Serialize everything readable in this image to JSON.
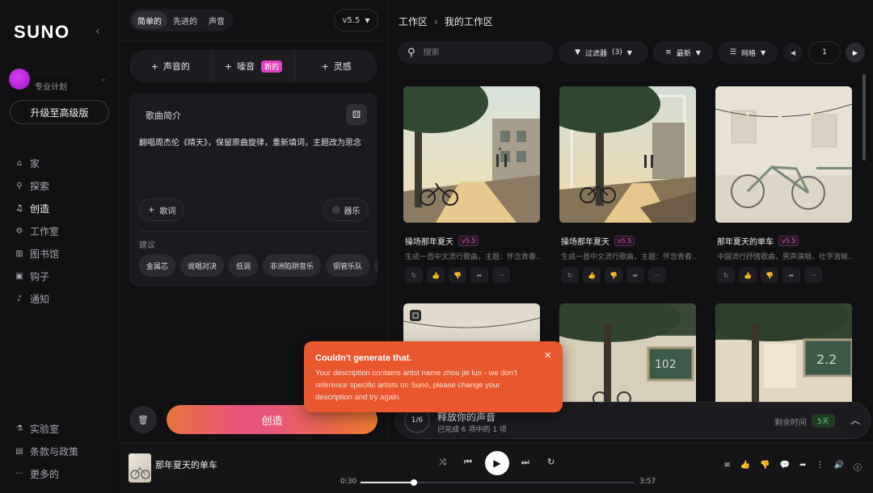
{
  "app": {
    "logo": "SUNO"
  },
  "user": {
    "name_blurred": "· · · · · · · · ·",
    "plan": "专业计划"
  },
  "sidebar": {
    "upgrade": "升级至高级版",
    "items": [
      {
        "label": "家",
        "icon": "home-icon",
        "glyph": "⌂"
      },
      {
        "label": "探索",
        "icon": "search-icon",
        "glyph": "⚲"
      },
      {
        "label": "创造",
        "icon": "music-note-icon",
        "glyph": "♫"
      },
      {
        "label": "工作室",
        "icon": "studio-icon",
        "glyph": "⚙"
      },
      {
        "label": "图书馆",
        "icon": "library-icon",
        "glyph": "▥"
      },
      {
        "label": "钩子",
        "icon": "hooks-icon",
        "glyph": "▣"
      },
      {
        "label": "通知",
        "icon": "bell-icon",
        "glyph": "♪"
      }
    ],
    "bottom": [
      {
        "label": "实验室",
        "icon": "flask-icon",
        "glyph": "⚗"
      },
      {
        "label": "条款与政策",
        "icon": "document-icon",
        "glyph": "▤"
      },
      {
        "label": "更多的",
        "icon": "more-icon",
        "glyph": "···"
      }
    ]
  },
  "create": {
    "tabs": [
      "简单的",
      "先进的",
      "声音"
    ],
    "version": "v5.5",
    "add": {
      "vocal": "声音的",
      "noise": "噪音",
      "new_badge": "新的",
      "inspiration": "灵感"
    },
    "desc_title": "歌曲简介",
    "desc_text": "翻唱周杰伦《晴天》，保留原曲旋律，重新填词，主题改为思念",
    "lyrics": "歌词",
    "instrumental": "器乐",
    "suggest_label": "建议",
    "suggestions": [
      "金属芯",
      "说唱对决",
      "低调",
      "非洲陷阱音乐",
      "铜管乐队",
      "…"
    ],
    "create_label": "创造"
  },
  "work": {
    "breadcrumb": [
      "工作区",
      "我的工作区"
    ],
    "search_placeholder": "搜索",
    "filter": "过滤器",
    "filter_count": "(3)",
    "sort": "最新",
    "view": "网格",
    "page": "1",
    "cards": [
      {
        "title": "操场那年夏天",
        "version": "v5.5",
        "sub": "生成一首中文流行歌曲，主题：怀念青春…"
      },
      {
        "title": "操场那年夏天",
        "version": "v5.5",
        "sub": "生成一首中文流行歌曲，主题：怀念青春…"
      },
      {
        "title": "那年夏天的单车",
        "version": "v5.5",
        "sub": "中国流行抒情歌曲，男声演唱，吐字清晰…"
      }
    ]
  },
  "progress": {
    "counter": "1/6",
    "title": "释放你的声音",
    "sub": "已完成 6 项中的 1 项",
    "remain_label": "剩余时间",
    "days": "5天"
  },
  "toast": {
    "title": "Couldn't generate that.",
    "body": "Your description contains artist name zhou jie lun - we don't reference specific artists on Suno, please change your description and try again."
  },
  "player": {
    "title": "那年夏天的单车",
    "sub": "· · · · · · · ·",
    "time_current": "0:30",
    "time_total": "3:57",
    "progress": 0.196
  }
}
